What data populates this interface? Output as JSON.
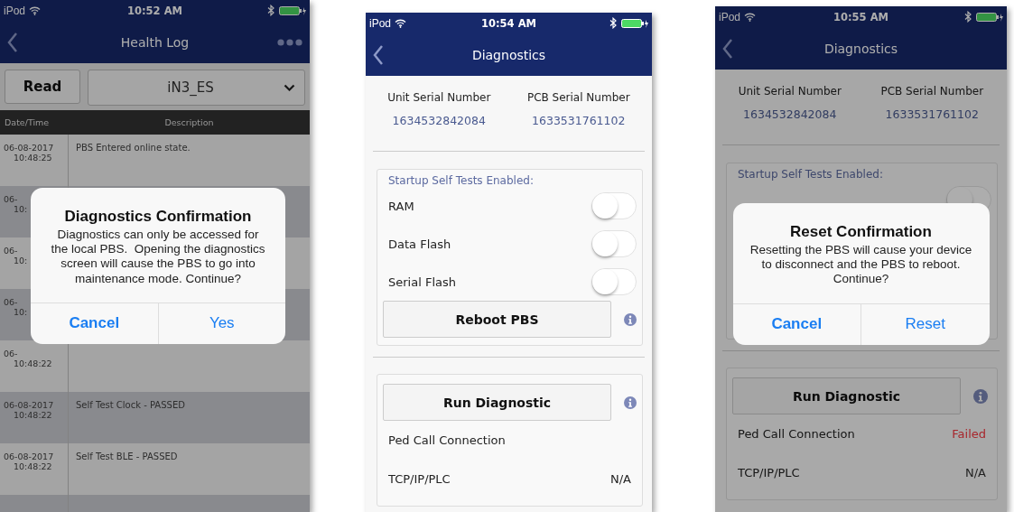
{
  "screens": [
    {
      "kind": "health_log",
      "status_bar": {
        "carrier": "iPod",
        "time": "10:52 AM"
      },
      "nav": {
        "title": "Health Log"
      },
      "read_button": "Read",
      "device_select": {
        "value": "iN3_ES"
      },
      "table": {
        "columns": [
          "Date/Time",
          "Description"
        ],
        "rows": [
          {
            "date": "06-08-2017",
            "time": "10:48:25",
            "description": "PBS Entered online state."
          },
          {
            "date": "06-",
            "time": "10:"
          },
          {
            "date": "06-",
            "time": "10:"
          },
          {
            "date": "06-",
            "time": "10:"
          },
          {
            "date": "06-",
            "time": "10:48:22"
          },
          {
            "date": "06-08-2017",
            "time": "10:48:22",
            "description": "Self Test Clock - PASSED"
          },
          {
            "date": "06-08-2017",
            "time": "10:48:22",
            "description": "Self Test BLE - PASSED"
          },
          {}
        ]
      },
      "dialog": {
        "title": "Diagnostics Confirmation",
        "message": "Diagnostics can only be accessed for the local PBS.  Opening the diagnostics screen will cause the PBS to go into maintenance mode. Continue?",
        "buttons": [
          "Cancel",
          "Yes"
        ]
      }
    },
    {
      "kind": "diagnostics",
      "status_bar": {
        "carrier": "iPod",
        "time": "10:54 AM"
      },
      "nav": {
        "title": "Diagnostics"
      },
      "serials": [
        {
          "label": "Unit Serial Number",
          "value": "1634532842084"
        },
        {
          "label": "PCB Serial Number",
          "value": "1633531761102"
        }
      ],
      "self_tests": {
        "heading": "Startup Self Tests Enabled:",
        "items": [
          {
            "label": "RAM",
            "on": false
          },
          {
            "label": "Data Flash",
            "on": false
          },
          {
            "label": "Serial Flash",
            "on": false
          }
        ],
        "reboot_button": "Reboot PBS"
      },
      "diagnostic": {
        "run_button": "Run Diagnostic",
        "results": [
          {
            "label": "Ped Call Connection"
          },
          {
            "label": "TCP/IP/PLC",
            "value": "N/A",
            "color": "#222222"
          }
        ]
      }
    },
    {
      "kind": "diagnostics",
      "status_bar": {
        "carrier": "iPod",
        "time": "10:55 AM"
      },
      "nav": {
        "title": "Diagnostics"
      },
      "serials": [
        {
          "label": "Unit Serial Number",
          "value": "1634532842084"
        },
        {
          "label": "PCB Serial Number",
          "value": "1633531761102"
        }
      ],
      "self_tests": {
        "heading": "Startup Self Tests Enabled:",
        "items": [
          {
            "on": false
          }
        ]
      },
      "diagnostic": {
        "run_button": "Run Diagnostic",
        "results": [
          {
            "label": "Ped Call Connection",
            "value": "Failed",
            "color": "#a8262c"
          },
          {
            "label": "TCP/IP/PLC",
            "value": "N/A",
            "color": "#222222"
          }
        ]
      },
      "dialog": {
        "title": "Reset Confirmation",
        "message": "Resetting the PBS will cause your device to disconnect and the PBS to reboot.  Continue?",
        "buttons": [
          "Cancel",
          "Reset"
        ]
      }
    }
  ]
}
